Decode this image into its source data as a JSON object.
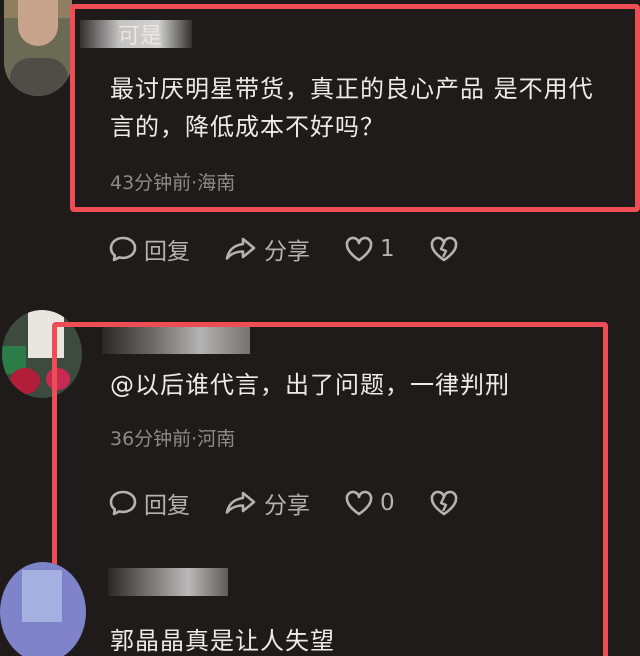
{
  "comments": [
    {
      "user_fragment": "可是",
      "text_line1": "最讨厌明星带货，真正的良心产品 是不用代",
      "text_line2": "言的，降低成本不好吗？",
      "meta": "43分钟前·海南",
      "reply_label": "回复",
      "share_label": "分享",
      "like_count": "1"
    },
    {
      "text_line1": "@以后谁代言，出了问题，一律判刑",
      "meta": "36分钟前·河南",
      "reply_label": "回复",
      "share_label": "分享",
      "like_count": "0"
    },
    {
      "text_line1": "郭晶晶真是让人失望"
    }
  ],
  "icons": {
    "reply": "reply-bubble-icon",
    "share": "share-arrow-icon",
    "like": "heart-icon",
    "dislike": "broken-heart-icon"
  },
  "colors": {
    "background": "#1f1b1a",
    "highlight_box": "#ef4d56",
    "text": "#ecebea",
    "meta": "#8f8987",
    "action": "#b7b2af"
  }
}
